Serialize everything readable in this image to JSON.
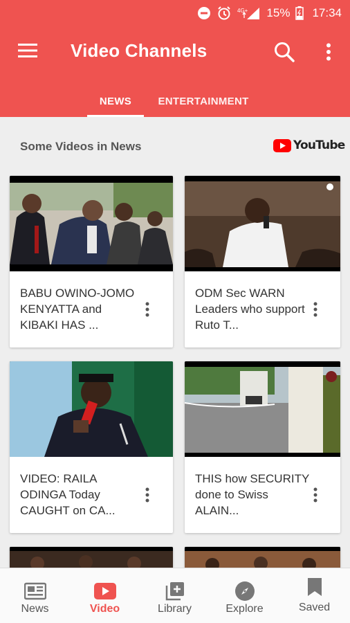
{
  "colors": {
    "accent": "#ef5350",
    "youtube_red": "#ff0000"
  },
  "status_bar": {
    "battery": "15%",
    "time": "17:34",
    "network": "4G+"
  },
  "app_bar": {
    "title": "Video Channels"
  },
  "tabs": [
    {
      "label": "NEWS",
      "active": true
    },
    {
      "label": "ENTERTAINMENT",
      "active": false
    }
  ],
  "section": {
    "title": "Some Videos in News",
    "source_logo_text": "YouTube"
  },
  "videos": [
    {
      "title": "BABU OWINO-JOMO KENYATTA and KIBAKI HAS ..."
    },
    {
      "title": "ODM Sec WARN Leaders who support Ruto T..."
    },
    {
      "title": "VIDEO: RAILA ODINGA Today CAUGHT on CA..."
    },
    {
      "title": "THIS how SECURITY done to Swiss ALAIN..."
    }
  ],
  "bottom_nav": [
    {
      "label": "News",
      "icon": "newspaper-icon",
      "active": false
    },
    {
      "label": "Video",
      "icon": "video-icon",
      "active": true
    },
    {
      "label": "Library",
      "icon": "library-icon",
      "active": false
    },
    {
      "label": "Explore",
      "icon": "compass-icon",
      "active": false
    },
    {
      "label": "Saved",
      "icon": "bookmark-icon",
      "active": false
    }
  ]
}
